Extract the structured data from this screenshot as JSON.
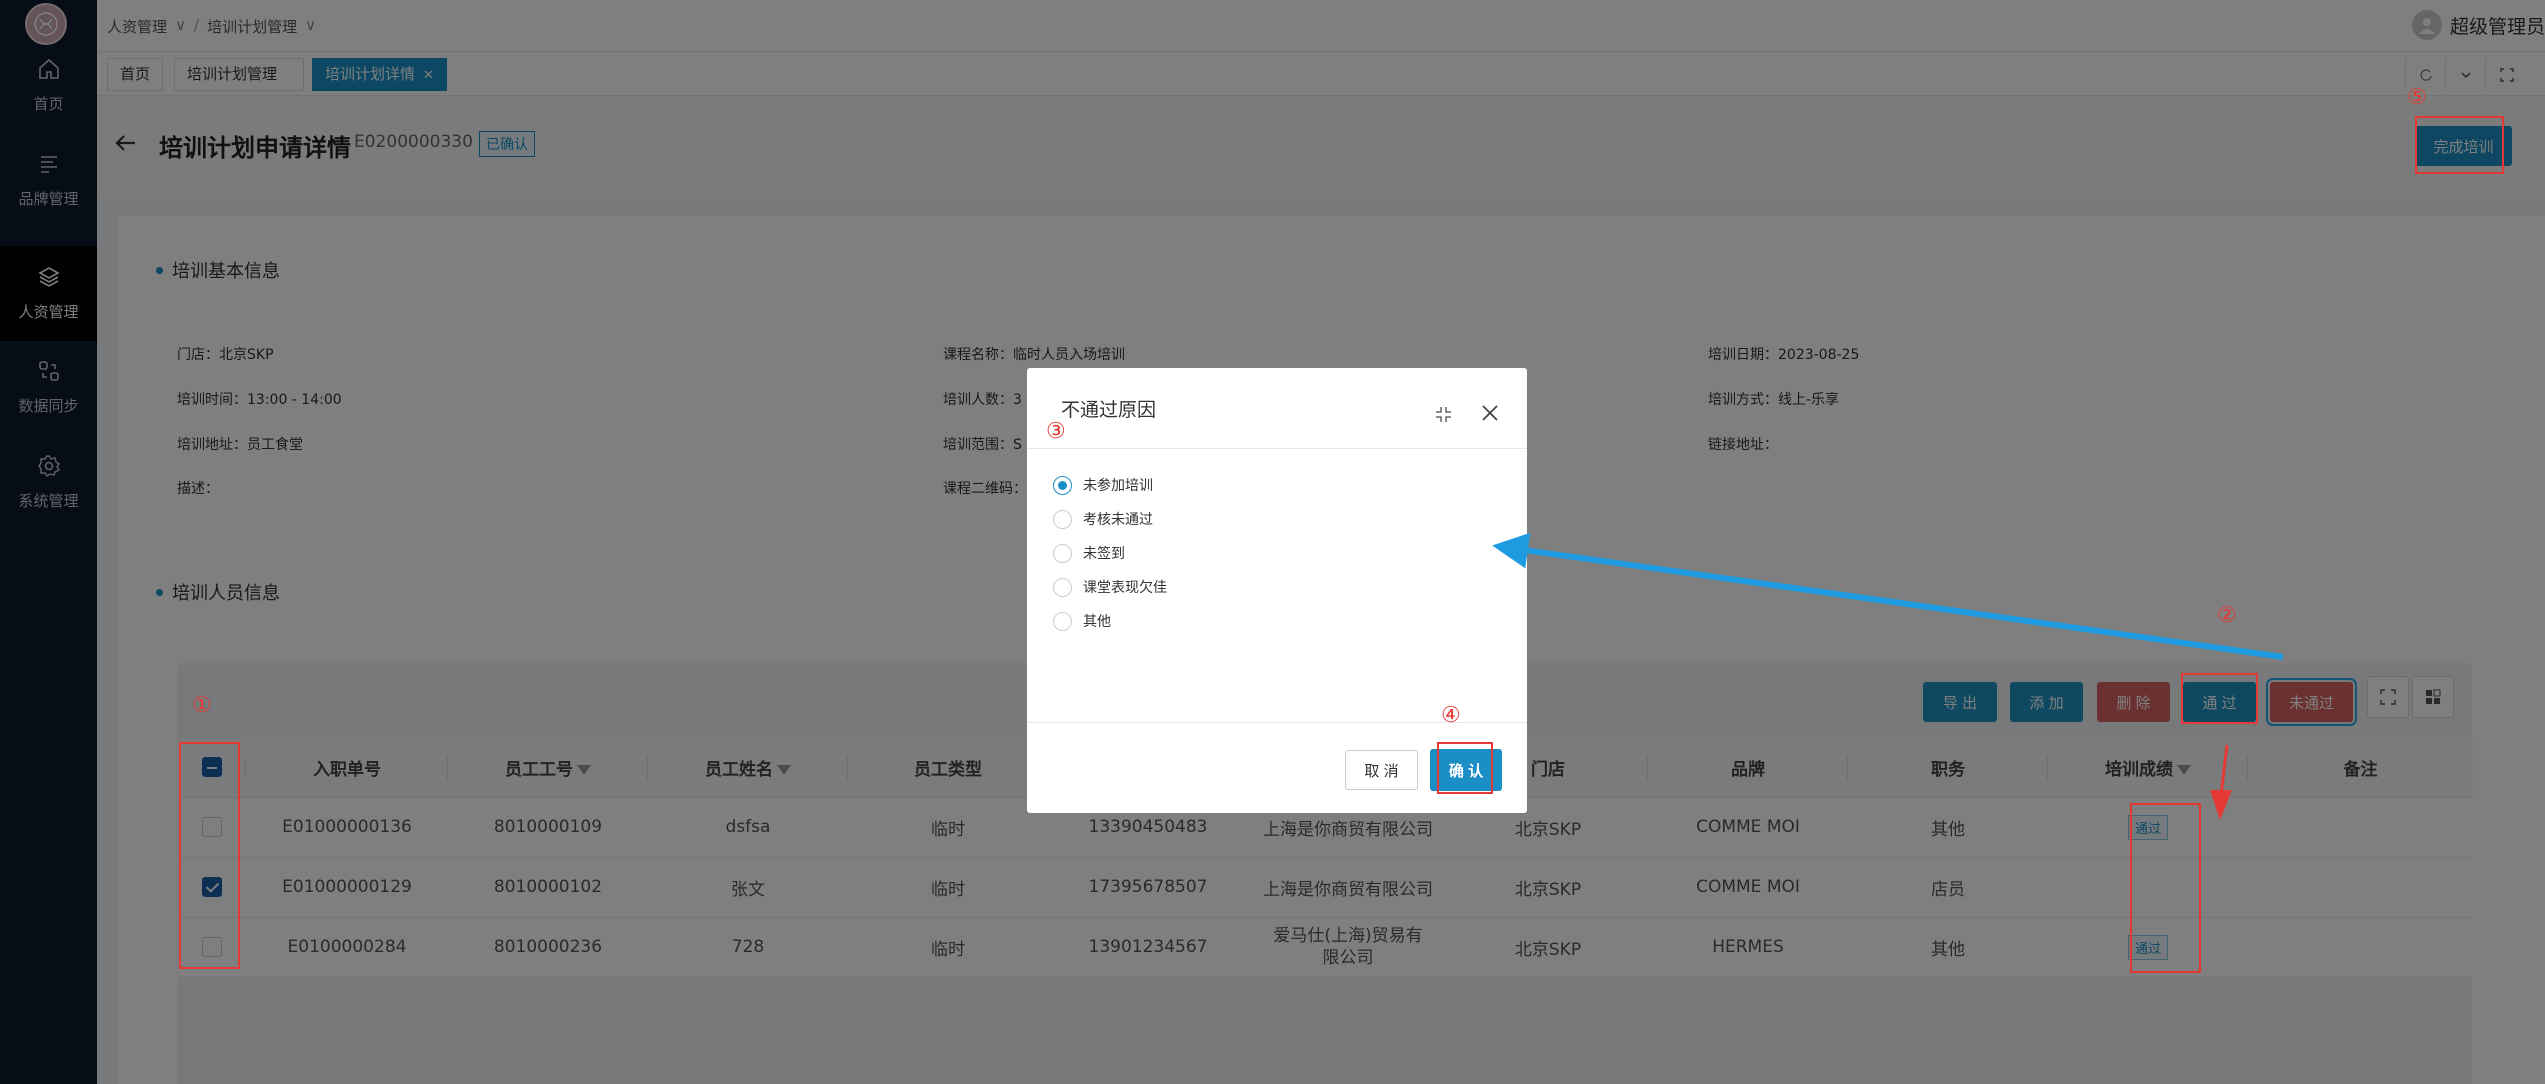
{
  "sidebar": {
    "logo": "brand-logo",
    "items": [
      {
        "label": "首页",
        "icon": "home-icon"
      },
      {
        "label": "品牌管理",
        "icon": "list-icon"
      },
      {
        "label": "人资管理",
        "icon": "layers-icon",
        "active": true
      },
      {
        "label": "数据同步",
        "icon": "sync-icon"
      },
      {
        "label": "系统管理",
        "icon": "gear-icon"
      }
    ]
  },
  "header": {
    "breadcrumb": [
      "人资管理",
      "培训计划管理"
    ],
    "user": "超级管理员"
  },
  "tabs": [
    {
      "label": "首页"
    },
    {
      "label": "培训计划管理"
    },
    {
      "label": "培训计划详情",
      "active": true
    }
  ],
  "page": {
    "title": "培训计划申请详情",
    "doc_no": "E0200000330",
    "status": "已确认",
    "finish_button": "完成培训"
  },
  "basic": {
    "section_title": "培训基本信息",
    "fields": [
      {
        "label": "门店：",
        "value": "北京SKP"
      },
      {
        "label": "课程名称：",
        "value": "临时人员入场培训"
      },
      {
        "label": "培训日期：",
        "value": "2023-08-25"
      },
      {
        "label": "培训时间：",
        "value": "13:00 - 14:00"
      },
      {
        "label": "培训人数：",
        "value": "3"
      },
      {
        "label": "培训方式：",
        "value": "线上-乐享"
      },
      {
        "label": "培训地址：",
        "value": "员工食堂"
      },
      {
        "label": "培训范围：",
        "value": "S"
      },
      {
        "label": "链接地址：",
        "value": ""
      },
      {
        "label": "描述：",
        "value": ""
      },
      {
        "label": "课程二维码：",
        "value": ""
      }
    ]
  },
  "staff": {
    "section_title": "培训人员信息",
    "buttons": {
      "export": "导 出",
      "add": "添 加",
      "delete": "删 除",
      "pass": "通 过",
      "fail": "未通过"
    },
    "columns": [
      "入职单号",
      "员工工号",
      "员工姓名",
      "员工类型",
      "",
      "",
      "门店",
      "品牌",
      "职务",
      "培训成绩",
      "备注"
    ],
    "rows": [
      {
        "checked": false,
        "entry_no": "E01000000136",
        "emp_no": "8010000109",
        "name": "dsfsa",
        "type": "临时",
        "phone": "13390450483",
        "company": "上海是你商贸有限公司",
        "store": "北京SKP",
        "brand": "COMME MOI",
        "position": "其他",
        "score": "通过",
        "remark": ""
      },
      {
        "checked": true,
        "entry_no": "E01000000129",
        "emp_no": "8010000102",
        "name": "张文",
        "type": "临时",
        "phone": "17395678507",
        "company": "上海是你商贸有限公司",
        "store": "北京SKP",
        "brand": "COMME MOI",
        "position": "店员",
        "score": "",
        "remark": ""
      },
      {
        "checked": false,
        "entry_no": "E0100000284",
        "emp_no": "8010000236",
        "name": "728",
        "type": "临时",
        "phone": "13901234567",
        "company": "爱马仕(上海)贸易有限公司",
        "store": "北京SKP",
        "brand": "HERMES",
        "position": "其他",
        "score": "通过",
        "remark": ""
      }
    ]
  },
  "modal": {
    "title": "不通过原因",
    "options": [
      "未参加培训",
      "考核未通过",
      "未签到",
      "课堂表现欠佳",
      "其他"
    ],
    "selected": 0,
    "cancel": "取 消",
    "confirm": "确 认"
  },
  "annotations": [
    "①",
    "②",
    "③",
    "④",
    "⑤"
  ],
  "colors": {
    "accent": "#1b8ec5",
    "danger": "#d76262",
    "annotation": "#e53935",
    "arrow": "#1e9be0",
    "sidebar": "#0d1b2d"
  }
}
